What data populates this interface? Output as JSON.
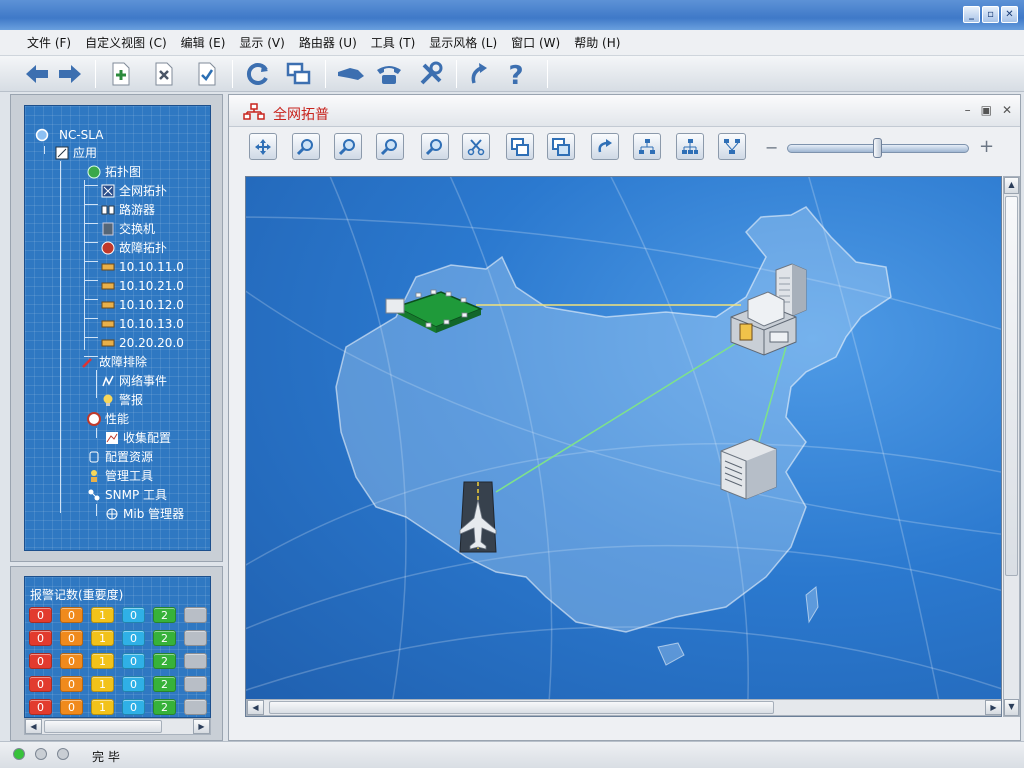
{
  "window": {
    "controls": [
      "minimize",
      "restore",
      "close"
    ]
  },
  "menu": [
    {
      "label": "文件 (F)"
    },
    {
      "label": "自定义视图 (C)"
    },
    {
      "label": "编辑 (E)"
    },
    {
      "label": "显示 (V)"
    },
    {
      "label": "路由器 (U)"
    },
    {
      "label": "工具 (T)"
    },
    {
      "label": "显示风格 (L)"
    },
    {
      "label": "窗口 (W)"
    },
    {
      "label": "帮助 (H)"
    }
  ],
  "toolbar": {
    "icons": [
      "back-arrow-icon",
      "forward-arrow-icon",
      "new-document-icon",
      "delete-document-icon",
      "check-document-icon",
      "refresh-icon",
      "windows-icon",
      "connect-icon",
      "telephone-icon",
      "tools-icon",
      "redo-icon",
      "help-icon"
    ]
  },
  "tree": {
    "root": "NC-SLA",
    "items": [
      {
        "label": "应用"
      },
      {
        "label": "拓扑图"
      },
      {
        "label": "全网拓扑"
      },
      {
        "label": "路游器"
      },
      {
        "label": "交换机"
      },
      {
        "label": "故障拓扑"
      },
      {
        "label": "10.10.11.0"
      },
      {
        "label": "10.10.21.0"
      },
      {
        "label": "10.10.12.0"
      },
      {
        "label": "10.10.13.0"
      },
      {
        "label": "20.20.20.0"
      },
      {
        "label": "故障排除"
      },
      {
        "label": "网络事件"
      },
      {
        "label": "警报"
      },
      {
        "label": "性能"
      },
      {
        "label": "收集配置"
      },
      {
        "label": "配置资源"
      },
      {
        "label": "管理工具"
      },
      {
        "label": "SNMP 工具"
      },
      {
        "label": "Mib 管理器"
      }
    ]
  },
  "alarm": {
    "title": "报警记数(重要度)",
    "colors": {
      "critical": "#e23b2e",
      "major": "#f08a1c",
      "minor": "#f2c21a",
      "warning": "#2fb0e6",
      "normal": "#37b23a",
      "unknown": "#b8bec6"
    },
    "rows": [
      [
        "0",
        "0",
        "1",
        "0",
        "2",
        ""
      ],
      [
        "0",
        "0",
        "1",
        "0",
        "2",
        ""
      ],
      [
        "0",
        "0",
        "1",
        "0",
        "2",
        ""
      ],
      [
        "0",
        "0",
        "1",
        "0",
        "2",
        ""
      ],
      [
        "0",
        "0",
        "1",
        "0",
        "2",
        ""
      ]
    ]
  },
  "topology": {
    "title": "全网拓普",
    "tool_icons": [
      "pan-icon",
      "zoom-in-icon",
      "zoom-out-icon",
      "zoom-fit-icon",
      "zoom-search-icon",
      "cut-icon",
      "copy-window-icon",
      "paste-window-icon",
      "rotate-icon",
      "layout-tree-icon",
      "layout-hierarchy-icon",
      "layout-spread-icon"
    ],
    "zoom_min_label": "−",
    "zoom_max_label": "+",
    "zoom_level": 0.5,
    "nodes": [
      {
        "name": "router-board-node",
        "kind": "router"
      },
      {
        "name": "datacenter-node",
        "kind": "datacenter"
      },
      {
        "name": "server-node",
        "kind": "server"
      },
      {
        "name": "airport-node",
        "kind": "airport"
      }
    ]
  },
  "status": {
    "text": "完 毕",
    "led_colors": [
      "#38c23b",
      "#c9ced4",
      "#c9ced4"
    ]
  }
}
